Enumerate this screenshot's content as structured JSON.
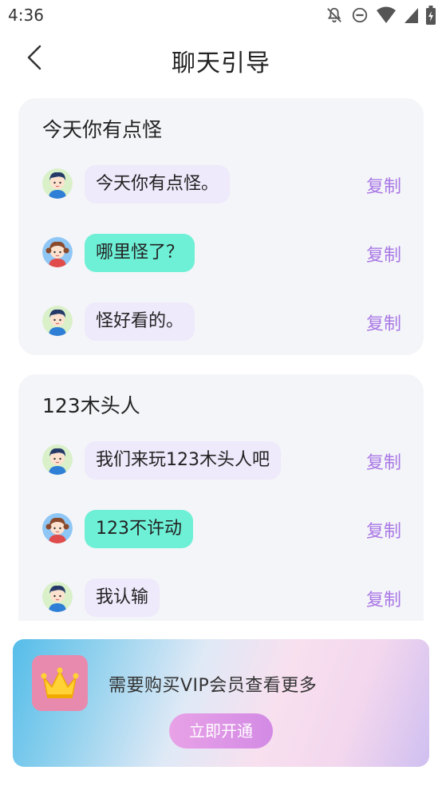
{
  "status_bar": {
    "time": "4:36",
    "icons": [
      "notifications-off-icon",
      "do-not-disturb-icon",
      "wifi-icon",
      "signal-icon",
      "battery-charging-icon"
    ]
  },
  "header": {
    "back_icon": "chevron-left-icon",
    "title": "聊天引导"
  },
  "colors": {
    "copy": "#a978e6",
    "bubble_boy": "#eee9fb",
    "bubble_girl": "#6ef0d6",
    "card_bg": "#f4f5f8",
    "title_underline": "#d7b0f5"
  },
  "cards": [
    {
      "title": "今天你有点怪",
      "messages": [
        {
          "speaker": "boy",
          "text": "今天你有点怪。",
          "copy": "复制"
        },
        {
          "speaker": "girl",
          "text": "哪里怪了？",
          "copy": "复制"
        },
        {
          "speaker": "boy",
          "text": "怪好看的。",
          "copy": "复制"
        }
      ]
    },
    {
      "title": "123木头人",
      "messages": [
        {
          "speaker": "boy",
          "text": "我们来玩123木头人吧",
          "copy": "复制"
        },
        {
          "speaker": "girl",
          "text": "123不许动",
          "copy": "复制"
        },
        {
          "speaker": "boy",
          "text": "我认输",
          "copy": "复制"
        }
      ]
    }
  ],
  "vip": {
    "icon": "crown-icon",
    "text": "需要购买VIP会员查看更多",
    "button": "立即开通"
  }
}
